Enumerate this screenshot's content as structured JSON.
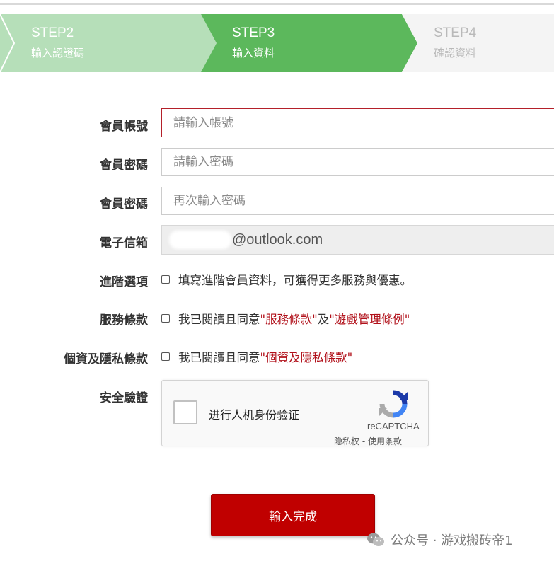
{
  "steps": [
    {
      "title": "STEP2",
      "subtitle": "輸入認證碼",
      "state": "done"
    },
    {
      "title": "STEP3",
      "subtitle": "輸入資料",
      "state": "active"
    },
    {
      "title": "STEP4",
      "subtitle": "確認資料",
      "state": "pending"
    }
  ],
  "colors": {
    "step_done": "#b6dfb9",
    "step_active": "#5cb85c",
    "step_pending": "#f3f3f3",
    "accent_red": "#c00000",
    "link_red": "#b1101a"
  },
  "form": {
    "account_label": "會員帳號",
    "account_placeholder": "請輸入帳號",
    "password_label": "會員密碼",
    "password_placeholder": "請輸入密碼",
    "password_confirm_label": "會員密碼",
    "password_confirm_placeholder": "再次輸入密碼",
    "email_label": "電子信箱",
    "email_domain": "@outlook.com",
    "advanced_label": "進階選項",
    "advanced_text": "填寫進階會員資料，可獲得更多服務與優惠。",
    "terms_label": "服務條款",
    "terms_prefix": "我已閱讀且同意",
    "terms_link1": "\"服務條款\"",
    "terms_and": "及",
    "terms_link2": "\"遊戲管理條例\"",
    "privacy_label": "個資及隱私條款",
    "privacy_prefix": "我已閱讀且同意",
    "privacy_link": "\"個資及隱私條款\"",
    "security_label": "安全驗證"
  },
  "recaptcha": {
    "label": "进行人机身份验证",
    "brand": "reCAPTCHA",
    "terms": "隐私权 - 使用条款"
  },
  "submit_label": "輸入完成",
  "watermark": {
    "icon": "wechat-icon",
    "text": "公众号 · 游戏搬砖帝1"
  }
}
